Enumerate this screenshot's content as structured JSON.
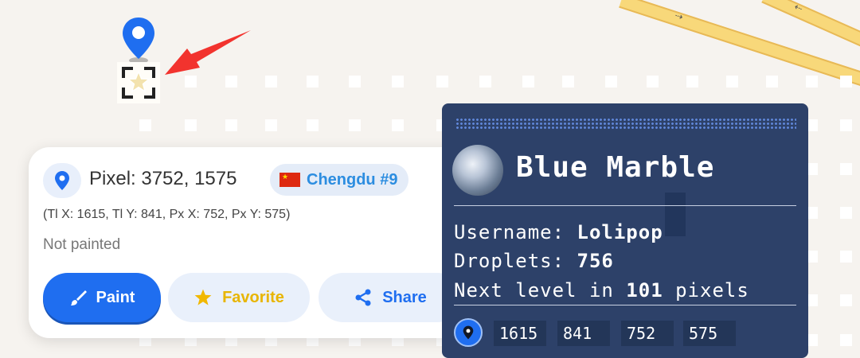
{
  "pixel_card": {
    "pixel_label": "Pixel: 3752, 1575",
    "region_name": "Chengdu #9",
    "tile_info": "(Tl X: 1615, Tl Y: 841, Px X: 752, Px Y: 575)",
    "status": "Not painted",
    "buttons": {
      "paint": "Paint",
      "favorite": "Favorite",
      "share": "Share"
    }
  },
  "blue_marble": {
    "title": "Blue Marble",
    "username_label": "Username:",
    "username": "Lolipop",
    "droplets_label": "Droplets:",
    "droplets": "756",
    "level_prefix": "Next level in",
    "level_value": "101",
    "level_suffix": "pixels",
    "coords": [
      "1615",
      "841",
      "752",
      "575"
    ]
  },
  "road_arrows": {
    "arrow_1": "⇢",
    "arrow_2": "⇠"
  },
  "colors": {
    "accent": "#1f6ef0",
    "panel": "#2d4169",
    "favorite": "#e8b500",
    "annotation_arrow": "#f2332e"
  },
  "icons": [
    "location-pin-icon",
    "star-icon",
    "brush-icon",
    "share-icon",
    "globe-icon"
  ]
}
